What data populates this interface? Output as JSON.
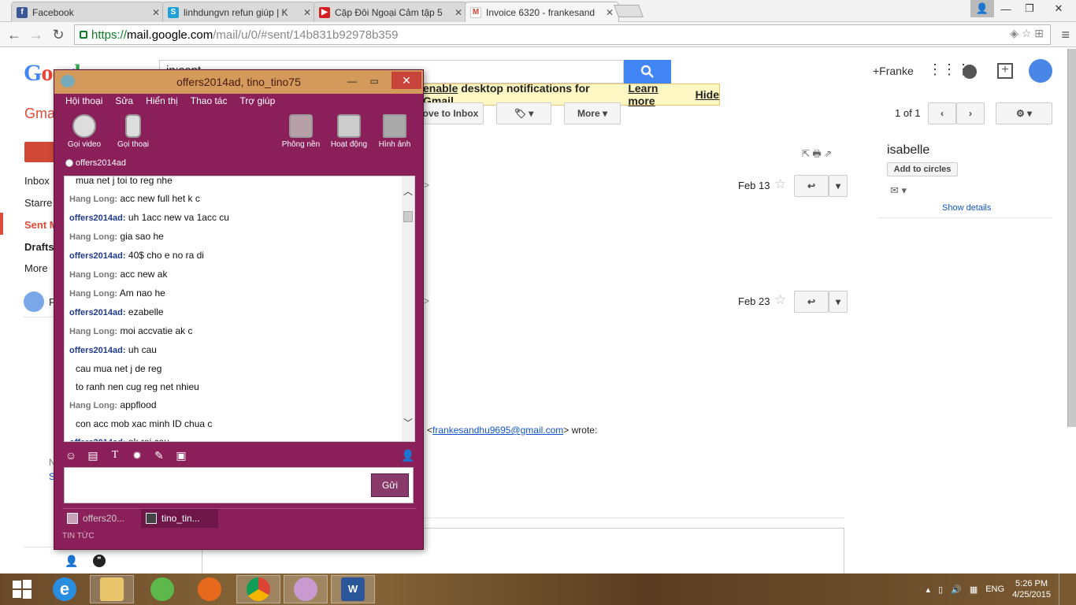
{
  "browser": {
    "tabs": [
      {
        "label": "Facebook",
        "icon": "facebook-icon",
        "color": "#3b5998",
        "glyph": "f"
      },
      {
        "label": "linhdungvn refun giúp | K",
        "icon": "skype-icon",
        "color": "#1da1d6",
        "glyph": "S"
      },
      {
        "label": "Cặp Đôi Ngoại Cảm tập 5",
        "icon": "youtube-icon",
        "color": "#d62020",
        "glyph": "▶"
      },
      {
        "label": "Invoice 6320 - frankesand",
        "icon": "gmail-icon",
        "color": "#d14836",
        "glyph": "M"
      }
    ],
    "url_proto": "https://",
    "url_host": "mail.google.com",
    "url_path": "/mail/u/0/#sent/14b831b92978b359"
  },
  "gmail": {
    "logo": "Google",
    "search_value": "in:sent",
    "user": "+Franke",
    "notif_text": "enable",
    "notif_rest": "desktop notifications for Gmail.",
    "notif_learn": "Learn more",
    "notif_hide": "Hide",
    "gmail_label": "Gma",
    "move_inbox": "ove to Inbox",
    "more_btn": "More",
    "pager": "1 of 1",
    "sidebar": [
      "Inbox",
      "Starre",
      "Sent M",
      "Drafts",
      "More"
    ],
    "contact_name": "isabelle",
    "add_circles": "Add to circles",
    "show_details": "Show details",
    "msg1_date": "Feb 13",
    "msg2_date": "Feb 23",
    "quote_email": "frankesandhu9695@gmail.com",
    "quote_pre": "<",
    "quote_post": "> wrote:",
    "side_letter_n": "N",
    "side_letter_s": "S",
    "side_letter_f": "F"
  },
  "messenger": {
    "title": "offers2014ad, tino_tino75",
    "menu": [
      "Hội thoại",
      "Sửa",
      "Hiển thị",
      "Thao tác",
      "Trợ giúp"
    ],
    "tools_left": [
      "Gọi video",
      "Gọi thoại"
    ],
    "tools_right": [
      "Phông nền",
      "Hoạt động",
      "Hình ảnh"
    ],
    "status_name": "offers2014ad",
    "messages": [
      {
        "from": "",
        "text": "mua net j toi to reg nhe",
        "cont": true
      },
      {
        "from": "Hang Long:",
        "text": "acc new full het k c",
        "me": false
      },
      {
        "from": "offers2014ad:",
        "text": "uh 1acc new va 1acc cu",
        "me": true
      },
      {
        "from": "Hang Long:",
        "text": "gia sao he",
        "me": false
      },
      {
        "from": "offers2014ad:",
        "text": "40$ cho e no ra di",
        "me": true
      },
      {
        "from": "Hang Long:",
        "text": "acc new ak",
        "me": false
      },
      {
        "from": "Hang Long:",
        "text": "Am nao he",
        "me": false
      },
      {
        "from": "offers2014ad:",
        "text": "ezabelle",
        "me": true
      },
      {
        "from": "Hang Long:",
        "text": "moi accvatie ak c",
        "me": false
      },
      {
        "from": "offers2014ad:",
        "text": "uh cau",
        "me": true
      },
      {
        "from": "",
        "text": "cau mua net j de reg",
        "cont": true
      },
      {
        "from": "",
        "text": "to ranh nen cug reg net nhieu",
        "cont": true
      },
      {
        "from": "Hang Long:",
        "text": "appflood",
        "me": false
      },
      {
        "from": "",
        "text": "con acc mob xac minh ID chua c",
        "cont": true
      },
      {
        "from": "offers2014ad:",
        "text": "ok roi cau",
        "me": true
      }
    ],
    "send": "Gửi",
    "tabs": [
      "offers20...",
      "tino_tin..."
    ],
    "news": "TIN TỨC"
  },
  "taskbar": {
    "lang": "ENG",
    "time": "5:26 PM",
    "date": "4/25/2015"
  }
}
